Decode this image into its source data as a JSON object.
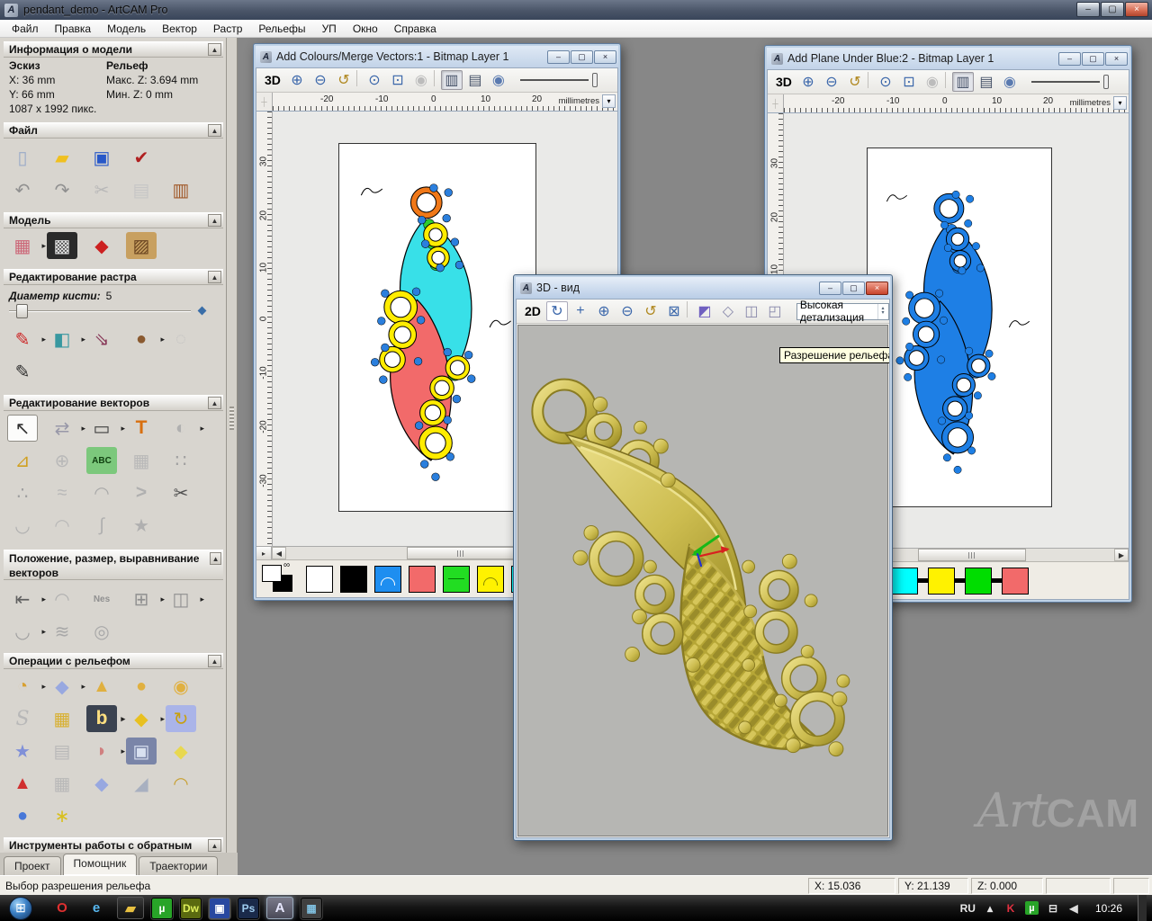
{
  "ui": {
    "collapse": "▲",
    "flyout": "▸",
    "min": "–",
    "max": "▢",
    "close": "×",
    "corner": "┼",
    "left_arrow": "◀",
    "right_arrow": "▶",
    "units_drop": "▾",
    "mini_pane": "▸",
    "link": "∞",
    "spin_up": "▴",
    "spin_down": "▾",
    "logo": "A"
  },
  "titlebar": {
    "title": "pendant_demo - ArtCAM Pro"
  },
  "menu": [
    "Файл",
    "Правка",
    "Модель",
    "Вектор",
    "Растр",
    "Рельефы",
    "УП",
    "Окно",
    "Справка"
  ],
  "sidebar": {
    "info": {
      "title": "Информация о модели",
      "sketch": "Эскиз",
      "relief": "Рельеф",
      "x": "X: 36 mm",
      "y": "Y: 66 mm",
      "maxz": "Макс. Z: 3.694 mm",
      "minz": "Мин. Z: 0 mm",
      "px": "1087 x 1992 пикс."
    },
    "file": {
      "title": "Файл",
      "row1": [
        {
          "name": "new-model-icon",
          "glyph": "▯",
          "fg": "#9aaac8"
        },
        {
          "name": "open-model-icon",
          "glyph": "▰",
          "fg": "#f0c020"
        },
        {
          "name": "save-model-icon",
          "glyph": "▣",
          "fg": "#2858c8"
        },
        {
          "name": "export-icon",
          "glyph": "✔",
          "fg": "#b02020"
        }
      ],
      "row2": [
        {
          "name": "undo-icon",
          "glyph": "↶",
          "fg": "#909090"
        },
        {
          "name": "redo-icon",
          "glyph": "↷",
          "fg": "#909090"
        },
        {
          "name": "cut-icon",
          "glyph": "✂",
          "fg": "#b8b8b8"
        },
        {
          "name": "copy-icon",
          "glyph": "▤",
          "fg": "#c6c6c6"
        },
        {
          "name": "paste-icon",
          "glyph": "▥",
          "fg": "#a05828"
        }
      ]
    },
    "model": {
      "title": "Модель",
      "row1": [
        {
          "name": "set-model-size-icon",
          "glyph": "▦",
          "fg": "#cc6677",
          "flyout": true
        },
        {
          "name": "greyscale-view-icon",
          "glyph": "▩",
          "fg": "#e0e0e0",
          "color": "#2a2a2a"
        },
        {
          "name": "lighting-icon",
          "glyph": "◆",
          "fg": "#cc2020"
        },
        {
          "name": "texture-icon",
          "glyph": "▨",
          "fg": "#6a4420",
          "color": "#c8a060"
        }
      ]
    },
    "raster": {
      "title": "Редактирование растра",
      "brush_label": "Диаметр кисти:",
      "brush_value": "5",
      "row1": [
        {
          "name": "paint-icon",
          "glyph": "✎",
          "fg": "#cc2828",
          "flyout": true
        },
        {
          "name": "flood-fill-icon",
          "glyph": "◧",
          "fg": "#3898a0",
          "flyout": true
        },
        {
          "name": "pick-colour-icon",
          "glyph": "⇘",
          "fg": "#883858"
        },
        {
          "name": "colour-palette-icon",
          "glyph": "●",
          "fg": "#8a5a30",
          "flyout": true
        },
        {
          "name": "eraser-icon",
          "glyph": "◌",
          "fg": "#c0c0c0"
        }
      ],
      "row2": [
        {
          "name": "draw-icon",
          "glyph": "✎",
          "fg": "#303030"
        }
      ]
    },
    "vectors": {
      "title": "Редактирование векторов",
      "row1": [
        {
          "name": "select-vectors-icon",
          "glyph": "↖",
          "fg": "#303030",
          "cls": "sel"
        },
        {
          "name": "transform-vectors-icon",
          "glyph": "⇄",
          "fg": "#9898a8",
          "flyout": true
        },
        {
          "name": "create-rectangle-icon",
          "glyph": "▭",
          "fg": "#404040",
          "flyout": true
        },
        {
          "name": "create-text-icon",
          "label": "T",
          "fg": "#d87010",
          "cls": "bold"
        },
        {
          "name": "mirror-vectors-icon",
          "glyph": "◐",
          "fg": "#b0b0b0",
          "flyout": true
        }
      ],
      "row2": [
        {
          "name": "measure-icon",
          "glyph": "⊿",
          "fg": "#d0a020"
        },
        {
          "name": "offset-vectors-icon",
          "glyph": "⊕",
          "fg": "#b8b8b8"
        },
        {
          "name": "create-text-abc-icon",
          "label": "ABC",
          "color": "#7cc87c",
          "fg": "#104010",
          "cls": "tiny"
        },
        {
          "name": "distort-vectors-icon",
          "glyph": "▦",
          "fg": "#b8b8b8"
        },
        {
          "name": "paste-array-icon",
          "glyph": "∷",
          "fg": "#a0a0a0"
        }
      ],
      "row3": [
        {
          "name": "node-editing-icon",
          "glyph": "∴",
          "fg": "#a0a0a0"
        },
        {
          "name": "smooth-nodes-icon",
          "glyph": "≈",
          "fg": "#b8b8b8"
        },
        {
          "name": "fit-arcs-icon",
          "glyph": "◠",
          "fg": "#a8a8a8"
        },
        {
          "name": "fit-polyline-icon",
          "glyph": ">",
          "fg": "#b0b0b0",
          "cls": "bold"
        },
        {
          "name": "trim-vectors-icon",
          "glyph": "✂",
          "fg": "#505050"
        }
      ],
      "row4": [
        {
          "name": "create-boundary-icon",
          "glyph": "◡",
          "fg": "#b0b0b0"
        },
        {
          "name": "fillet-icon",
          "glyph": "◠",
          "fg": "#b8b8b8"
        },
        {
          "name": "slice-vector-icon",
          "glyph": "∫",
          "fg": "#b0b0b0"
        },
        {
          "name": "vector-doctor-icon",
          "glyph": "★",
          "fg": "#b0b0b0"
        }
      ]
    },
    "position": {
      "title": "Положение, размер, выравнивание векторов",
      "row1": [
        {
          "name": "align-vectors-icon",
          "glyph": "⇤",
          "fg": "#606060",
          "flyout": true
        },
        {
          "name": "text-on-curve-icon",
          "glyph": "◠",
          "fg": "#b0b0b0"
        },
        {
          "name": "nesting-icon",
          "label": "Nes",
          "fg": "#909090",
          "cls": "tiny"
        },
        {
          "name": "block-copy-icon",
          "glyph": "⊞",
          "fg": "#909090",
          "flyout": true
        },
        {
          "name": "weld-vectors-icon",
          "glyph": "◫",
          "fg": "#909090",
          "flyout": true
        }
      ],
      "row2": [
        {
          "name": "join-vectors-icon",
          "glyph": "◡",
          "fg": "#a0a0a0",
          "flyout": true
        },
        {
          "name": "distort-waves-icon",
          "glyph": "≋",
          "fg": "#a8a8a8"
        },
        {
          "name": "spiral-icon",
          "glyph": "◎",
          "fg": "#a8a8a8"
        }
      ]
    },
    "relief": {
      "title": "Операции с рельефом",
      "row1": [
        {
          "name": "shape-editor-icon",
          "glyph": "◔",
          "fg": "#d8a030",
          "flyout": true
        },
        {
          "name": "zero-plane-icon",
          "glyph": "◆",
          "fg": "#98a8e0",
          "flyout": true
        },
        {
          "name": "add-relief-icon",
          "glyph": "▲",
          "fg": "#e0b040"
        },
        {
          "name": "subtract-relief-icon",
          "glyph": "●",
          "fg": "#e0b040"
        },
        {
          "name": "merge-relief-icon",
          "glyph": "◉",
          "fg": "#e0b040"
        }
      ],
      "row2": [
        {
          "name": "smooth-relief-icon",
          "label": "S",
          "fg": "#b8b8b8",
          "cls": "italic"
        },
        {
          "name": "texture-weave-icon",
          "glyph": "▦",
          "fg": "#d8b030"
        },
        {
          "name": "emboss-icon",
          "label": "b",
          "color": "#3a4250",
          "fg": "#ffe080",
          "cls": "bold",
          "flyout": true
        },
        {
          "name": "offset-relief-icon",
          "glyph": "◆",
          "fg": "#e8c020",
          "flyout": true
        },
        {
          "name": "invert-relief-icon",
          "glyph": "↻",
          "fg": "#c8a010",
          "color": "#aab4e8"
        }
      ],
      "row3": [
        {
          "name": "star-relief-icon",
          "glyph": "★",
          "fg": "#8090d8"
        },
        {
          "name": "copy-relief-icon",
          "glyph": "▤",
          "fg": "#b8b8b8"
        },
        {
          "name": "sculpt-icon",
          "glyph": "◗",
          "fg": "#d08080",
          "flyout": true
        },
        {
          "name": "face-wizard-icon",
          "glyph": "▣",
          "fg": "#d8e0f0",
          "color": "#7a85a8"
        },
        {
          "name": "relief-layer-icon",
          "glyph": "◆",
          "fg": "#e8d850"
        }
      ],
      "row4": [
        {
          "name": "turn-model-icon",
          "glyph": "▲",
          "fg": "#d03030"
        },
        {
          "name": "envelope-distort-icon",
          "glyph": "▦",
          "fg": "#b8b8b8"
        },
        {
          "name": "pillow-relief-icon",
          "glyph": "◆",
          "fg": "#98a8e0"
        },
        {
          "name": "angled-plane-icon",
          "glyph": "◢",
          "fg": "#a8b0c0"
        },
        {
          "name": "two-rail-sweep-icon",
          "glyph": "◠",
          "fg": "#c8a030"
        }
      ],
      "row5": [
        {
          "name": "wrap-sphere-icon",
          "glyph": "●",
          "fg": "#4878d8"
        },
        {
          "name": "texture-flow-icon",
          "glyph": "∗",
          "fg": "#d8c020"
        }
      ]
    },
    "reverse": {
      "title": "Инструменты  работы  с  обратным"
    }
  },
  "tabs": [
    {
      "name": "tab-project",
      "label": "Проект"
    },
    {
      "name": "tab-assistant",
      "label": "Помощник",
      "active": true
    },
    {
      "name": "tab-toolpaths",
      "label": "Траектории"
    }
  ],
  "status": {
    "message": "Выбор разрешения рельефа",
    "x": "X: 15.036",
    "y": "Y: 21.139",
    "z": "Z: 0.000"
  },
  "taskbar": {
    "items": [
      {
        "name": "taskbar-opera",
        "glyph": "O",
        "fg": "#e03030",
        "cls": "tbtn"
      },
      {
        "name": "taskbar-ie",
        "glyph": "e",
        "fg": "#58b8f0",
        "cls": "tbtn"
      },
      {
        "name": "taskbar-explorer",
        "glyph": "▰",
        "fg": "#e8c040",
        "cls": "tbtn framed"
      },
      {
        "name": "taskbar-utorrent",
        "glyph": "µ",
        "fg": "#ffffff",
        "color": "#28a428",
        "cls": "tbtn sq"
      },
      {
        "name": "taskbar-dreamweaver",
        "label": "Dw",
        "fg": "#dff05a",
        "color": "#5a6a10",
        "cls": "tbtn sq"
      },
      {
        "name": "taskbar-save-app",
        "glyph": "▣",
        "fg": "#ffffff",
        "color": "#2848a0",
        "cls": "tbtn sq framed"
      },
      {
        "name": "taskbar-photoshop",
        "label": "Ps",
        "fg": "#9ecdf0",
        "color": "#1a2a4a",
        "cls": "tbtn sq"
      },
      {
        "name": "taskbar-artcam",
        "glyph": "A",
        "fg": "#e8e8ff",
        "cls": "tbtn active"
      },
      {
        "name": "taskbar-viewer",
        "glyph": "▦",
        "fg": "#80c0e0",
        "color": "#404040",
        "cls": "tbtn sq"
      }
    ],
    "start_glyph": "⊞"
  },
  "tray": {
    "items": [
      {
        "name": "tray-language",
        "label": "RU",
        "cls": "txt"
      },
      {
        "name": "tray-expand-icon",
        "glyph": "▴"
      },
      {
        "name": "tray-kaspersky",
        "glyph": "K",
        "fg": "#e03040"
      },
      {
        "name": "tray-utorrent",
        "glyph": "µ",
        "fg": "#ffffff",
        "color": "#28a428",
        "cls": "sq"
      },
      {
        "name": "tray-network-icon",
        "glyph": "⊟",
        "fg": "#dddddd"
      },
      {
        "name": "tray-volume-icon",
        "glyph": "◀",
        "fg": "#dddddd"
      }
    ],
    "time": "10:26"
  },
  "w1": {
    "title": "Add Colours/Merge Vectors:1 - Bitmap Layer 1",
    "toolbar": [
      {
        "name": "view-3d-button",
        "label": "3D",
        "cls": "txt"
      },
      {
        "name": "zoom-in-icon",
        "glyph": "⊕",
        "fg": "#3a66aa"
      },
      {
        "name": "zoom-out-icon",
        "glyph": "⊖",
        "fg": "#3a66aa"
      },
      {
        "name": "zoom-last-icon",
        "glyph": "↺",
        "fg": "#b08820"
      },
      {
        "name": "separator",
        "cls": "sep",
        "interactable": false
      },
      {
        "name": "zoom-1to1-icon",
        "glyph": "⊙",
        "fg": "#3a66aa"
      },
      {
        "name": "zoom-fit-icon",
        "glyph": "⊡",
        "fg": "#3a66aa"
      },
      {
        "name": "zoom-selection-icon",
        "glyph": "◉",
        "fg": "#bcbcbc"
      },
      {
        "name": "separator",
        "cls": "sep",
        "interactable": false
      },
      {
        "name": "bitmap-visibility-icon",
        "glyph": "▥",
        "fg": "#445066",
        "cls": "pressed"
      },
      {
        "name": "vector-visibility-icon",
        "glyph": "▤",
        "fg": "#445066"
      },
      {
        "name": "preview-relief-icon",
        "glyph": "◉",
        "fg": "#5a7ab0"
      }
    ],
    "hticks": [
      {
        "label": "-20",
        "css": "left:53px",
        "interactable": false
      },
      {
        "label": "-10",
        "css": "left:114px",
        "interactable": false
      },
      {
        "label": "0",
        "css": "left:176px",
        "interactable": false
      },
      {
        "label": "10",
        "css": "left:231px",
        "interactable": false
      },
      {
        "label": "20",
        "css": "left:288px",
        "interactable": false
      }
    ],
    "vticks": [
      {
        "label": "30",
        "css": "top:50px",
        "interactable": false
      },
      {
        "label": "20",
        "css": "top:110px",
        "interactable": false
      },
      {
        "label": "10",
        "css": "top:168px",
        "interactable": false
      },
      {
        "label": "0",
        "css": "top:225px",
        "interactable": false
      },
      {
        "label": "-10",
        "css": "top:285px",
        "interactable": false
      },
      {
        "label": "-20",
        "css": "top:345px",
        "interactable": false
      },
      {
        "label": "-30",
        "css": "top:405px",
        "interactable": false
      }
    ],
    "units": "millimetres",
    "palette": [
      {
        "name": "swatch-white",
        "color": "#ffffff"
      },
      {
        "name": "swatch-black",
        "color": "#000000"
      },
      {
        "name": "swatch-blue",
        "color": "#1e8ef0",
        "fg": "#ffffff",
        "cls": "mark-arc"
      },
      {
        "name": "swatch-red",
        "color": "#f26a6a"
      },
      {
        "name": "swatch-green",
        "color": "#22dd22",
        "fg": "#007700",
        "cls": "mark-line"
      },
      {
        "name": "swatch-yellow",
        "color": "#fff200",
        "fg": "#888800",
        "cls": "mark-arc"
      },
      {
        "name": "swatch-cyan",
        "color": "#00ffff"
      }
    ],
    "colors": {
      "leaf1": "#38e0e8",
      "leaf2": "#f26a6a",
      "ring": "#ffec00",
      "ringtop": "#f07818",
      "green": "#2ecc2e",
      "dot": "#2b7fdd"
    }
  },
  "w2": {
    "title": "Add Plane Under Blue:2 - Bitmap Layer 1",
    "palette": [
      {
        "name": "swatch-blue",
        "color": "#1e7fe5",
        "fg": "#ffffff",
        "cls": "mark-line"
      },
      {
        "name": "palette-link",
        "cls": "link",
        "interactable": false
      },
      {
        "name": "swatch-orange",
        "color": "#ff8500"
      },
      {
        "name": "palette-link",
        "cls": "link",
        "interactable": false
      },
      {
        "name": "swatch-cyan",
        "color": "#00ffff"
      },
      {
        "name": "palette-link",
        "cls": "link",
        "interactable": false
      },
      {
        "name": "swatch-yellow",
        "color": "#fff200"
      },
      {
        "name": "palette-link",
        "cls": "link",
        "interactable": false
      },
      {
        "name": "swatch-green",
        "color": "#00dd00"
      },
      {
        "name": "palette-link",
        "cls": "link",
        "interactable": false
      },
      {
        "name": "swatch-red",
        "color": "#f26a6a"
      }
    ],
    "colors": {
      "leaf1": "#1e7fe5",
      "leaf2": "#1e7fe5",
      "ring": "#1e7fe5",
      "ringtop": "#1e7fe5",
      "green": "#1e7fe5",
      "dot": "#1e7fe5"
    }
  },
  "w3": {
    "title": "3D - вид",
    "toolbar": [
      {
        "name": "view-2d-button",
        "label": "2D",
        "cls": "txt"
      },
      {
        "name": "rotate-view-icon",
        "glyph": "↻",
        "fg": "#3a66aa",
        "cls": "boxed"
      },
      {
        "name": "pan-view-icon",
        "glyph": "+",
        "fg": "#3a66aa",
        "cls": "bold"
      },
      {
        "name": "zoom-in-icon",
        "glyph": "⊕",
        "fg": "#3a66aa"
      },
      {
        "name": "zoom-out-icon",
        "glyph": "⊖",
        "fg": "#3a66aa"
      },
      {
        "name": "zoom-last-icon",
        "glyph": "↺",
        "fg": "#b08820"
      },
      {
        "name": "zoom-all-icon",
        "glyph": "⊠",
        "fg": "#3a66aa"
      },
      {
        "name": "separator",
        "cls": "sep",
        "interactable": false
      },
      {
        "name": "iso-view-icon",
        "glyph": "◩",
        "fg": "#7060c0"
      },
      {
        "name": "view-along-x-icon",
        "glyph": "◇",
        "fg": "#8888aa"
      },
      {
        "name": "view-along-y-icon",
        "glyph": "◫",
        "fg": "#8888aa"
      },
      {
        "name": "view-along-z-icon",
        "glyph": "◰",
        "fg": "#8888aa"
      }
    ],
    "detail": "Высокая детализация",
    "tooltip": "Разрешение рельефа"
  },
  "watermark": {
    "art": "Art",
    "cam": "CAM"
  }
}
